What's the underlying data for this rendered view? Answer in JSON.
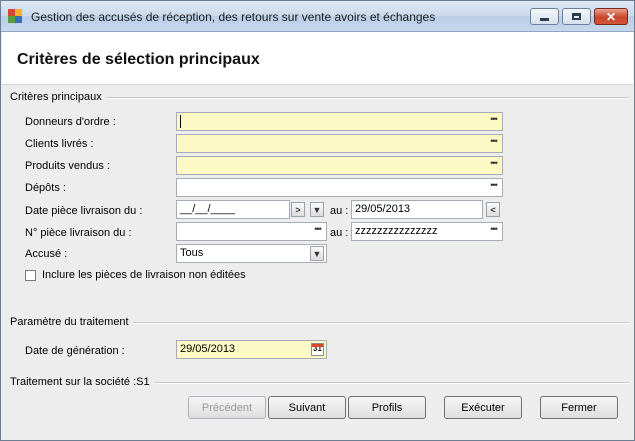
{
  "window": {
    "title": "Gestion des accusés de réception, des retours sur vente avoirs et échanges",
    "minimize_icon": "minimize-icon",
    "maximize_icon": "maximize-icon",
    "close_icon": "close-icon"
  },
  "header": {
    "title": "Critères de sélection principaux"
  },
  "sections": {
    "main_criteria": "Critères principaux",
    "processing_params": "Paramètre du traitement",
    "company_processing": "Traitement sur la société :S1"
  },
  "fields": {
    "donneurs_label": "Donneurs d'ordre :",
    "donneurs_value": "",
    "clients_label": "Clients livrés :",
    "clients_value": "",
    "produits_label": "Produits vendus :",
    "produits_value": "",
    "depots_label": "Dépôts :",
    "depots_value": "",
    "date_label": "Date pièce livraison du  :",
    "date_from_value": "__/__/____",
    "date_to_label": "au :",
    "date_to_value": "29/05/2013",
    "num_label": "N° pièce livraison du :",
    "num_from_value": "",
    "num_to_label": "au :",
    "num_to_value": "zzzzzzzzzzzzzzz",
    "accuse_label": "Accusé :",
    "accuse_value": "Tous",
    "include_label": "Inclure les pièces de livraison non éditées",
    "gen_date_label": "Date de génération :",
    "gen_date_value": "29/05/2013",
    "calendar_day": "31"
  },
  "buttons": {
    "previous": "Précédent",
    "next": "Suivant",
    "profiles": "Profils",
    "execute": "Exécuter",
    "close": "Fermer"
  },
  "ellipsis_glyph": "•••",
  "colors": {
    "required_field": "#fdf9c5",
    "accent_arrow": "#e05a1e"
  }
}
